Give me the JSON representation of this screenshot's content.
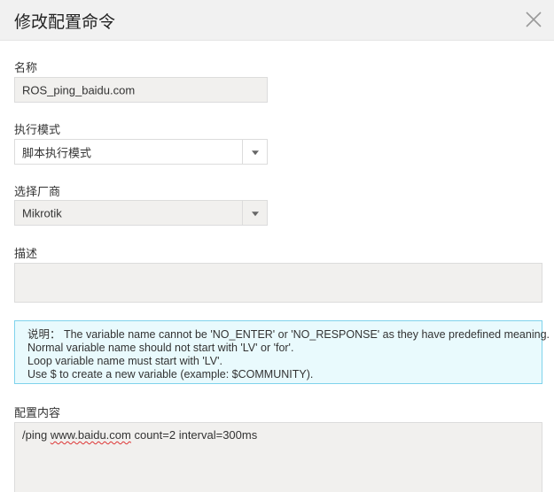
{
  "dialog": {
    "title": "修改配置命令"
  },
  "form": {
    "name_label": "名称",
    "name_value": "ROS_ping_baidu.com",
    "mode_label": "执行模式",
    "mode_value": "脚本执行模式",
    "vendor_label": "选择厂商",
    "vendor_value": "Mikrotik",
    "desc_label": "描述",
    "desc_value": "",
    "config_label": "配置内容",
    "config_prefix": "/ping ",
    "config_domain": "www.baidu.com",
    "config_suffix": " count=2 interval=300ms"
  },
  "info": {
    "line1": "说明： The variable name cannot be 'NO_ENTER' or 'NO_RESPONSE' as they have predefined meaning.",
    "line2": "Normal variable name should not start with 'LV' or 'for'.",
    "line3": "Loop variable name must start with 'LV'.",
    "line4": "Use $ to create a new variable (example: $COMMUNITY)."
  },
  "icons": {
    "close": "close-icon",
    "dropdown": "chevron-down-icon"
  },
  "colors": {
    "header_bg": "#f1f1f1",
    "field_bg": "#f1f0ee",
    "info_bg": "#e9fafd",
    "info_border": "#7fd3ec"
  }
}
